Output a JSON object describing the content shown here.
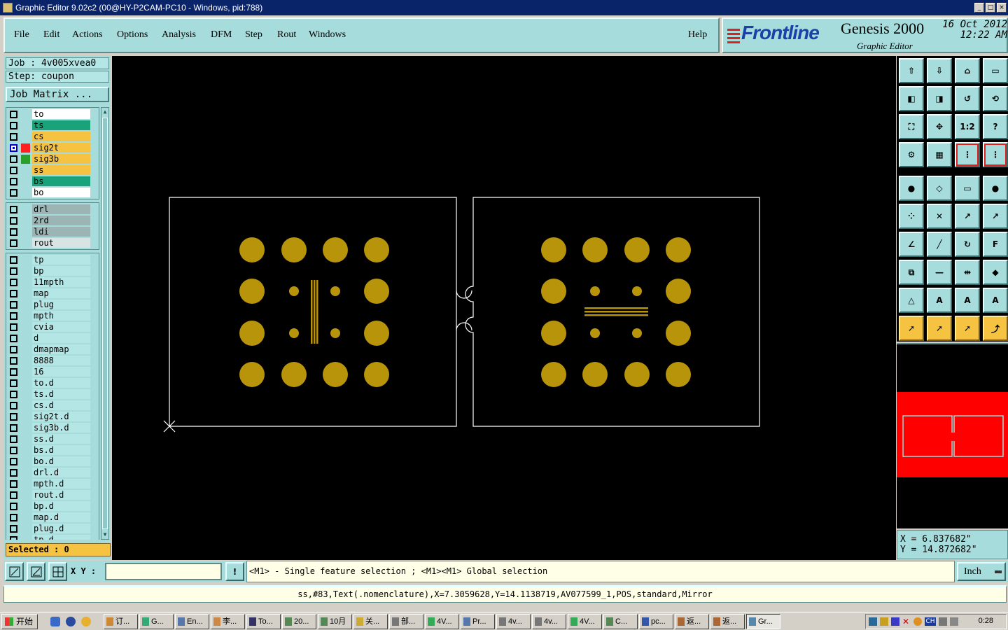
{
  "window": {
    "title": "Graphic Editor 9.02c2 (00@HY-P2CAM-PC10 - Windows, pid:788)",
    "buttons": [
      "_",
      "□",
      "×"
    ]
  },
  "menu": {
    "items": [
      "File",
      "Edit",
      "Actions",
      "Options",
      "Analysis",
      "DFM",
      "Step",
      "Rout",
      "Windows"
    ],
    "help": "Help"
  },
  "brand": {
    "logo": "Frontline",
    "product": "Genesis 2000",
    "subtitle": "Graphic Editor",
    "date": "16 Oct 2012",
    "time": "12:22 AM"
  },
  "job": {
    "job_line": "Job : 4v005xvea0",
    "step_line": "Step: coupon",
    "matrix_button": "Job Matrix ..."
  },
  "layers": {
    "board": [
      {
        "name": "to",
        "color": "#ffffff",
        "swatch": ""
      },
      {
        "name": "ts",
        "color": "#1aa37a",
        "swatch": ""
      },
      {
        "name": "cs",
        "color": "#f5c242",
        "swatch": ""
      },
      {
        "name": "sig2t",
        "color": "#f5c242",
        "swatch": "#ff2020",
        "active": true
      },
      {
        "name": "sig3b",
        "color": "#f5c242",
        "swatch": "#2aa02a"
      },
      {
        "name": "ss",
        "color": "#f5c242",
        "swatch": ""
      },
      {
        "name": "bs",
        "color": "#1aa37a",
        "swatch": ""
      },
      {
        "name": "bo",
        "color": "#ffffff",
        "swatch": ""
      }
    ],
    "drill": [
      {
        "name": "drl",
        "color": "#9cb4b4"
      },
      {
        "name": "2rd",
        "color": "#9cb4b4"
      },
      {
        "name": "ldi",
        "color": "#9cb4b4"
      },
      {
        "name": "rout",
        "color": "#d8e4e4"
      }
    ],
    "misc": [
      "tp",
      "bp",
      "11mpth",
      "map",
      "plug",
      "mpth",
      "cvia",
      "d",
      "dmapmap",
      "8888",
      "16",
      "to.d",
      "ts.d",
      "cs.d",
      "sig2t.d",
      "sig3b.d",
      "ss.d",
      "bs.d",
      "bo.d",
      "drl.d",
      "mpth.d",
      "rout.d",
      "bp.d",
      "map.d",
      "plug.d",
      "tp.d"
    ]
  },
  "selected_text": "Selected : 0",
  "coords": {
    "x_line": "X  =  6.837682\"",
    "y_line": "Y  =  14.872682\""
  },
  "command": {
    "xy_label": "X Y :",
    "xy_value": "",
    "bang": "!",
    "prompt": "<M1> - Single feature selection ; <M1><M1> Global selection",
    "units": "Inch"
  },
  "status_line": "ss,#83,Text(.nomenclature),X=7.3059628,Y=14.1138719,AV077599_1,POS,standard,Mirror",
  "toolbar": {
    "icons": [
      "open-step-icon",
      "save-icon",
      "home-icon",
      "window-icon",
      "pan-left-icon",
      "pan-right-icon",
      "undo-icon",
      "redo-icon",
      "zoom-fit-icon",
      "zoom-center-icon",
      "one-to-one-label",
      "help-icon",
      "snap-settings-icon",
      "grid-icon",
      "display-layers-icon",
      "display-layers-2-icon",
      "add-pad-icon",
      "add-surface-icon",
      "measure-icon",
      "circle-icon",
      "move-nodes-icon",
      "delete-icon",
      "resize-icon",
      "transform-icon",
      "angle-icon",
      "line-icon",
      "arc-icon",
      "text-icon",
      "copy-icon",
      "break-icon",
      "dimension-icon",
      "shapes-icon",
      "triangle-icon",
      "polygon-a-icon",
      "polygon-b-icon",
      "polygon-c-icon",
      "pointer-icon",
      "select-icon",
      "highlight-icon",
      "route-icon"
    ],
    "one_to_one": "1:2",
    "question": "?"
  },
  "taskbar": {
    "start": "开始",
    "tasks": [
      "订...",
      "G...",
      "En...",
      "李...",
      "To...",
      "20...",
      "10月",
      "关...",
      "部...",
      "4V...",
      "Pr...",
      "4v...",
      "4v...",
      "4V...",
      "C...",
      "pc...",
      "返...",
      "返...",
      "Gr..."
    ],
    "clock": "0:28",
    "lang": "CH"
  },
  "colors": {
    "copper": "#b8940a",
    "outline": "#ffffff",
    "panel": "#a6dcdc",
    "overview_red": "#ff0000"
  }
}
